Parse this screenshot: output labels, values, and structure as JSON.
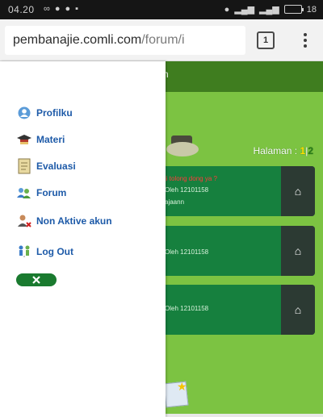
{
  "status_bar": {
    "time": "04.20",
    "battery_label": "18"
  },
  "browser": {
    "url_domain": "pembanajie.comli.com",
    "url_path": "/forum/i",
    "tab_count": "1"
  },
  "page": {
    "header_fragment": "um",
    "halaman_label": "Halaman :",
    "pages": [
      "1",
      "2"
    ],
    "page_separator": "|",
    "cards": [
      {
        "title": "ji tolong dong ya ?",
        "author": "Oleh 12101158",
        "excerpt": "ajaann"
      },
      {
        "title": "",
        "author": "Oleh 12101158",
        "excerpt": ""
      },
      {
        "title": "",
        "author": "Oleh 12101158",
        "excerpt": ""
      }
    ]
  },
  "drawer": {
    "items": [
      {
        "label": "Profilku",
        "icon": "profile-icon"
      },
      {
        "label": "Materi",
        "icon": "graduation-cap-icon"
      },
      {
        "label": "Evaluasi",
        "icon": "document-icon"
      },
      {
        "label": "Forum",
        "icon": "users-icon"
      },
      {
        "label": "Non Aktive akun",
        "icon": "remove-user-icon"
      },
      {
        "label": "Log Out",
        "icon": "logout-people-icon"
      }
    ],
    "close_icon": "close-icon"
  },
  "colors": {
    "header_green": "#3f7d1f",
    "page_green": "#7cc342",
    "card_green": "#16803e",
    "card_accent": "#2c3a33",
    "menu_text": "#1d5aa8",
    "close_button": "#1a7a2f"
  }
}
